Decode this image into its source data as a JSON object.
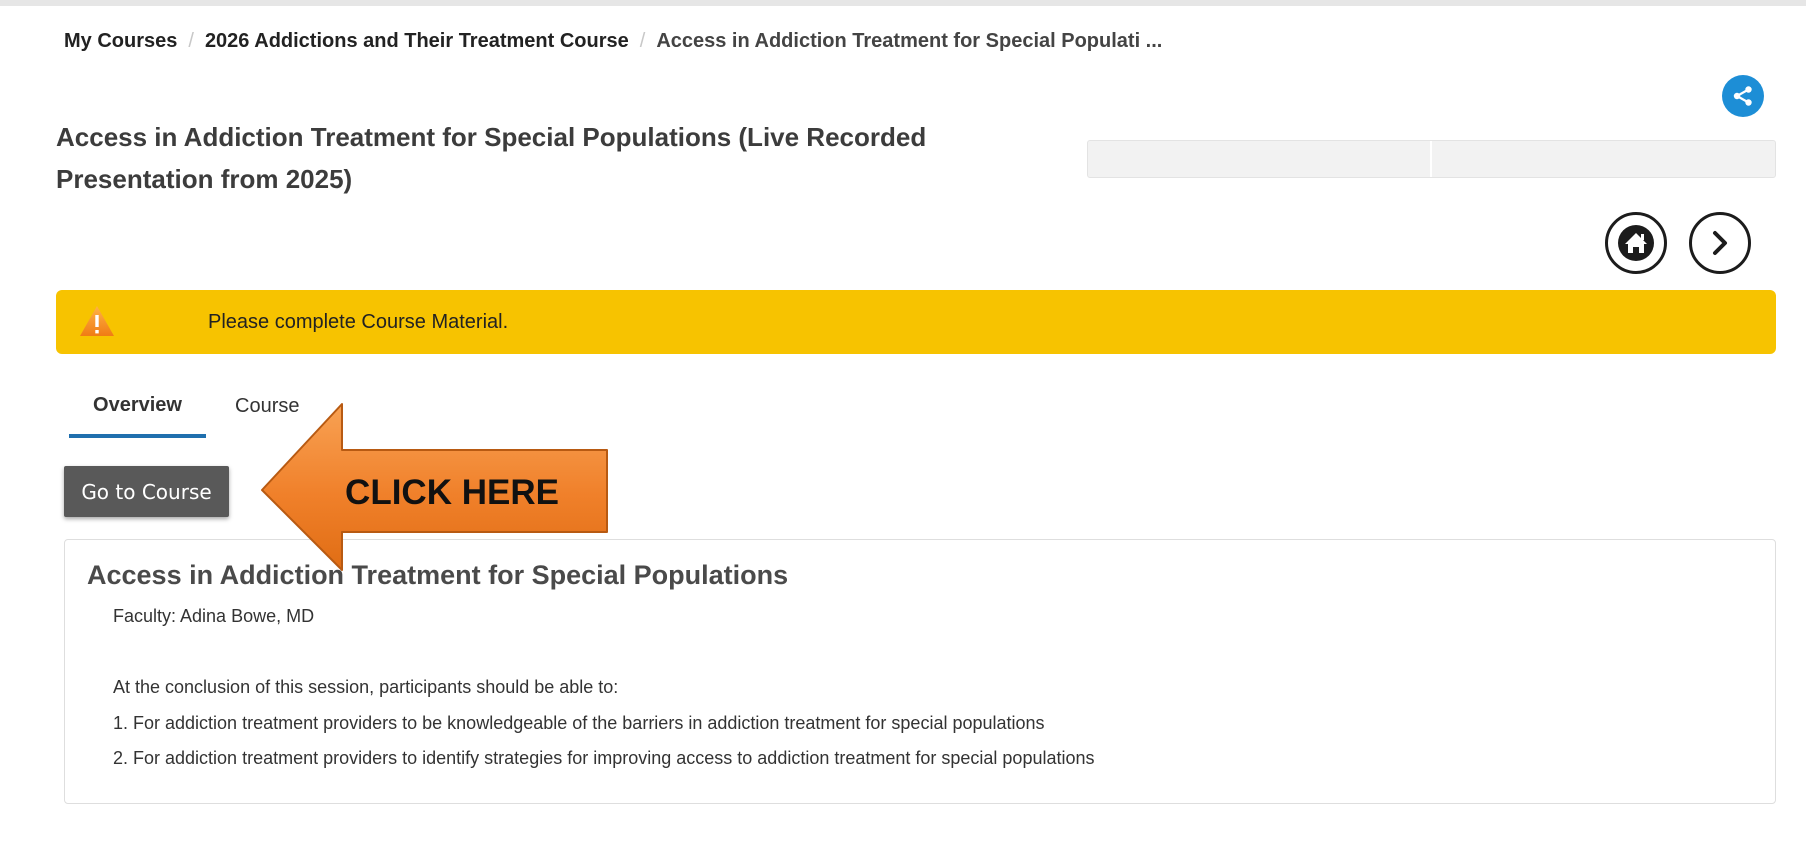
{
  "breadcrumb": {
    "items": [
      "My Courses",
      "2026 Addictions and Their Treatment Course"
    ],
    "current": "Access in Addiction Treatment for Special Populati ...",
    "separator": "/"
  },
  "page": {
    "title": "Access in Addiction Treatment for Special Populations (Live Recorded Presentation from 2025)"
  },
  "alert": {
    "message": "Please complete Course Material.",
    "color": "#f7c300",
    "icon": "warning-icon"
  },
  "tabs": [
    "Overview",
    "Course"
  ],
  "active_tab": "Overview",
  "actions": {
    "go_to_course": "Go to Course",
    "home_icon": "home-icon",
    "next_icon": "chevron-right-icon",
    "share_icon": "share-icon"
  },
  "callout": {
    "text": "CLICK HERE",
    "color": "#f28a2e"
  },
  "overview": {
    "heading": "Access in Addiction Treatment for Special Populations",
    "faculty": "Faculty: Adina Bowe, MD",
    "objectives_intro": "At the conclusion of this session, participants should be able to:",
    "objectives": [
      "1. For addiction treatment providers to be knowledgeable of the barriers in addiction treatment for special populations",
      "2. For addiction treatment providers to identify strategies for improving access to addiction treatment for special populations"
    ]
  },
  "colors": {
    "accent_tab": "#1f6fae",
    "share_button": "#1d8ed6",
    "button_bg": "#595959"
  }
}
